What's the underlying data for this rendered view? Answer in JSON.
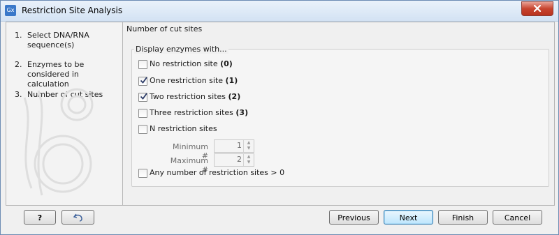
{
  "window": {
    "title": "Restriction Site Analysis",
    "app_icon_text": "Gx"
  },
  "sidebar": {
    "steps": [
      {
        "num": "1.",
        "label": "Select DNA/RNA sequence(s)"
      },
      {
        "num": "2.",
        "label": "Enzymes to be considered in calculation"
      },
      {
        "num": "3.",
        "label": "Number of cut sites"
      }
    ]
  },
  "content": {
    "title": "Number of cut sites",
    "group_title": "Display enzymes with...",
    "options": [
      {
        "text": "No restriction site ",
        "count": "(0)",
        "checked": false
      },
      {
        "text": "One restriction site ",
        "count": "(1)",
        "checked": true
      },
      {
        "text": "Two restriction sites ",
        "count": "(2)",
        "checked": true
      },
      {
        "text": "Three restriction sites ",
        "count": "(3)",
        "checked": false
      },
      {
        "text": "N restriction sites",
        "count": "",
        "checked": false
      }
    ],
    "minimum": {
      "label": "Minimum #",
      "value": "1"
    },
    "maximum": {
      "label": "Maximum #",
      "value": "2"
    },
    "any_option": {
      "text": "Any number of restriction sites > 0",
      "checked": false
    }
  },
  "footer": {
    "help_label": "?",
    "previous_label": "Previous",
    "next_label": "Next",
    "finish_label": "Finish",
    "cancel_label": "Cancel"
  },
  "colors": {
    "title_bar": "#d3e2f3",
    "close_button": "#c7442f",
    "default_button": "#bee6fd"
  }
}
